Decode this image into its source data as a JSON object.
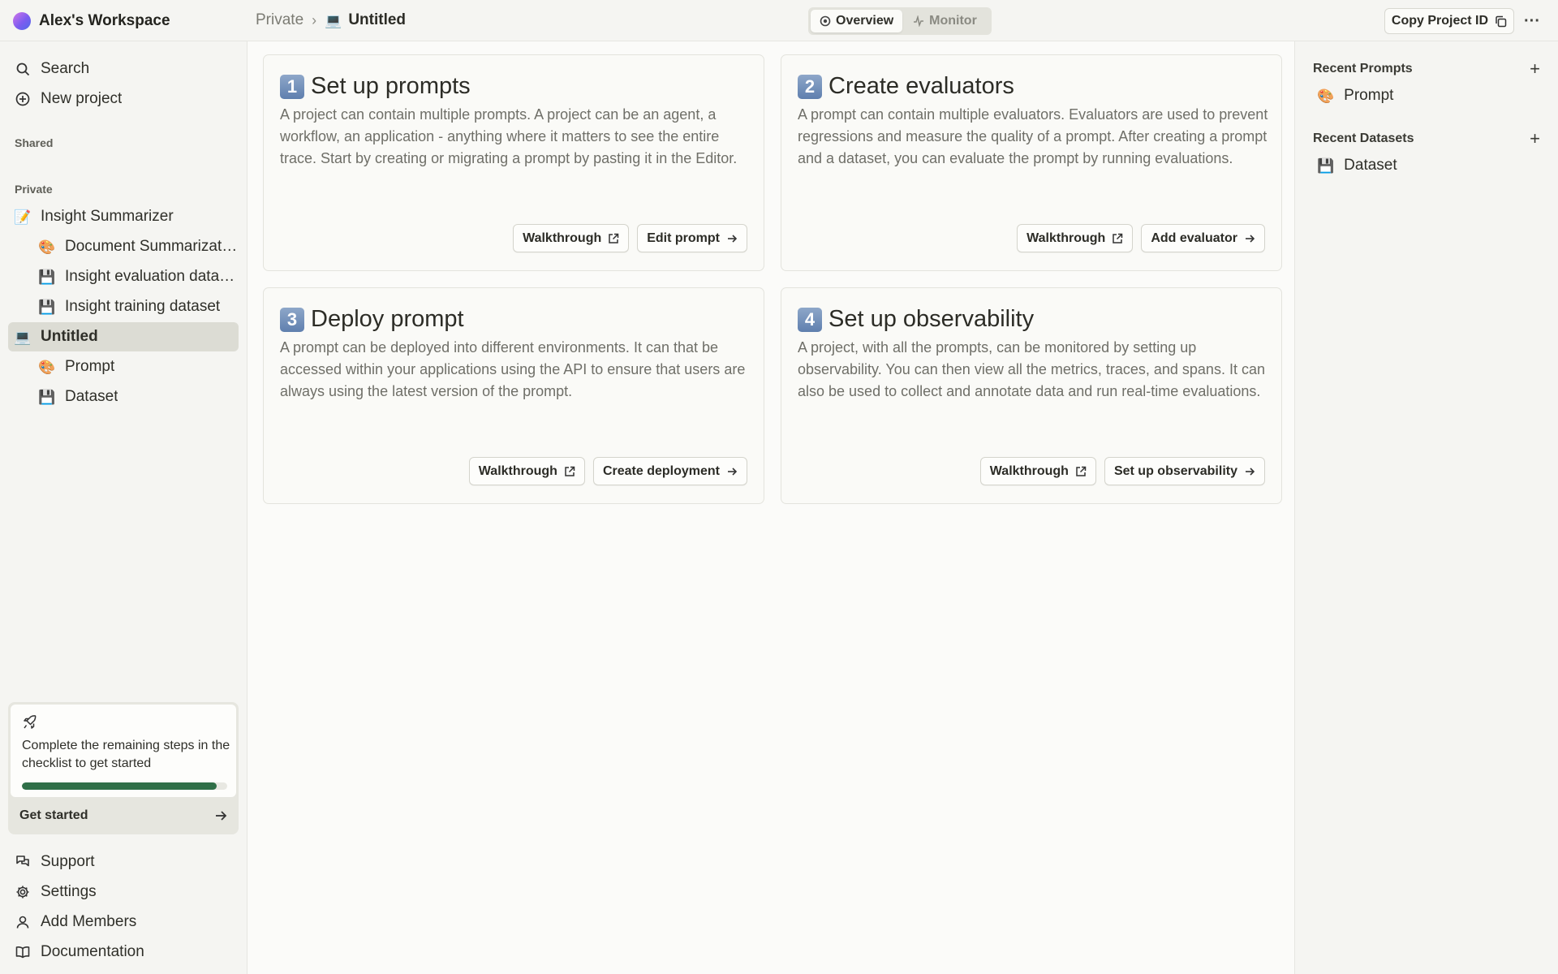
{
  "topbar": {
    "workspace_name": "Alex's Workspace",
    "breadcrumb_parent": "Private",
    "breadcrumb_separator": "›",
    "breadcrumb_current": "Untitled",
    "tabs": [
      {
        "label": "Overview"
      },
      {
        "label": "Monitor"
      }
    ],
    "copy_label": "Copy Project ID",
    "more_label": "···"
  },
  "sidebar": {
    "search_label": "Search",
    "new_project_label": "New project",
    "shared_label": "Shared",
    "private_label": "Private",
    "items": [
      {
        "label": "Insight Summarizer",
        "icon": "📝"
      },
      {
        "label": "Document Summarization",
        "icon": "🎨"
      },
      {
        "label": "Insight evaluation dataset",
        "icon": "💾"
      },
      {
        "label": "Insight training dataset",
        "icon": "💾"
      },
      {
        "label": "Untitled",
        "icon": "💻"
      },
      {
        "label": "Prompt",
        "icon": "🎨"
      },
      {
        "label": "Dataset",
        "icon": "💾"
      }
    ],
    "checklist": {
      "text": "Complete the remaining steps in the checklist to get started",
      "progress": 0.95,
      "cta_label": "Get started"
    },
    "footer": {
      "support_label": "Support",
      "settings_label": "Settings",
      "members_label": "Add Members",
      "docs_label": "Documentation"
    }
  },
  "cards": [
    {
      "number": "1",
      "title": "Set up prompts",
      "body": "A project can contain multiple prompts. A project can be an agent, a workflow, an application - anything where it matters to see the entire trace. Start by creating or migrating a prompt by pasting it in the Editor.",
      "walkthrough_label": "Walkthrough",
      "action_label": "Edit prompt"
    },
    {
      "number": "2",
      "title": "Create evaluators",
      "body": "A prompt can contain multiple evaluators. Evaluators are used to prevent regressions and measure the quality of a prompt. After creating a prompt and a dataset, you can evaluate the prompt by running evaluations.",
      "walkthrough_label": "Walkthrough",
      "action_label": "Add evaluator"
    },
    {
      "number": "3",
      "title": "Deploy prompt",
      "body": "A prompt can be deployed into different environments. It can that be accessed within your applications using the API to ensure that users are always using the latest version of the prompt.",
      "walkthrough_label": "Walkthrough",
      "action_label": "Create deployment"
    },
    {
      "number": "4",
      "title": "Set up observability",
      "body": "A project, with all the prompts, can be monitored by setting up observability. You can then view all the metrics, traces, and spans. It can also be used to collect and annotate data and run real-time evaluations.",
      "walkthrough_label": "Walkthrough",
      "action_label": "Set up observability"
    }
  ],
  "right_panel": {
    "recent_prompts_label": "Recent Prompts",
    "recent_prompts": [
      {
        "label": "Prompt",
        "icon": "🎨"
      }
    ],
    "recent_datasets_label": "Recent Datasets",
    "recent_datasets": [
      {
        "label": "Dataset",
        "icon": "💾"
      }
    ],
    "add_label": "+"
  },
  "colors": {
    "accent_green": "#2f6f48",
    "background": "#f5f5f2",
    "main_background": "#fbfbf9"
  }
}
